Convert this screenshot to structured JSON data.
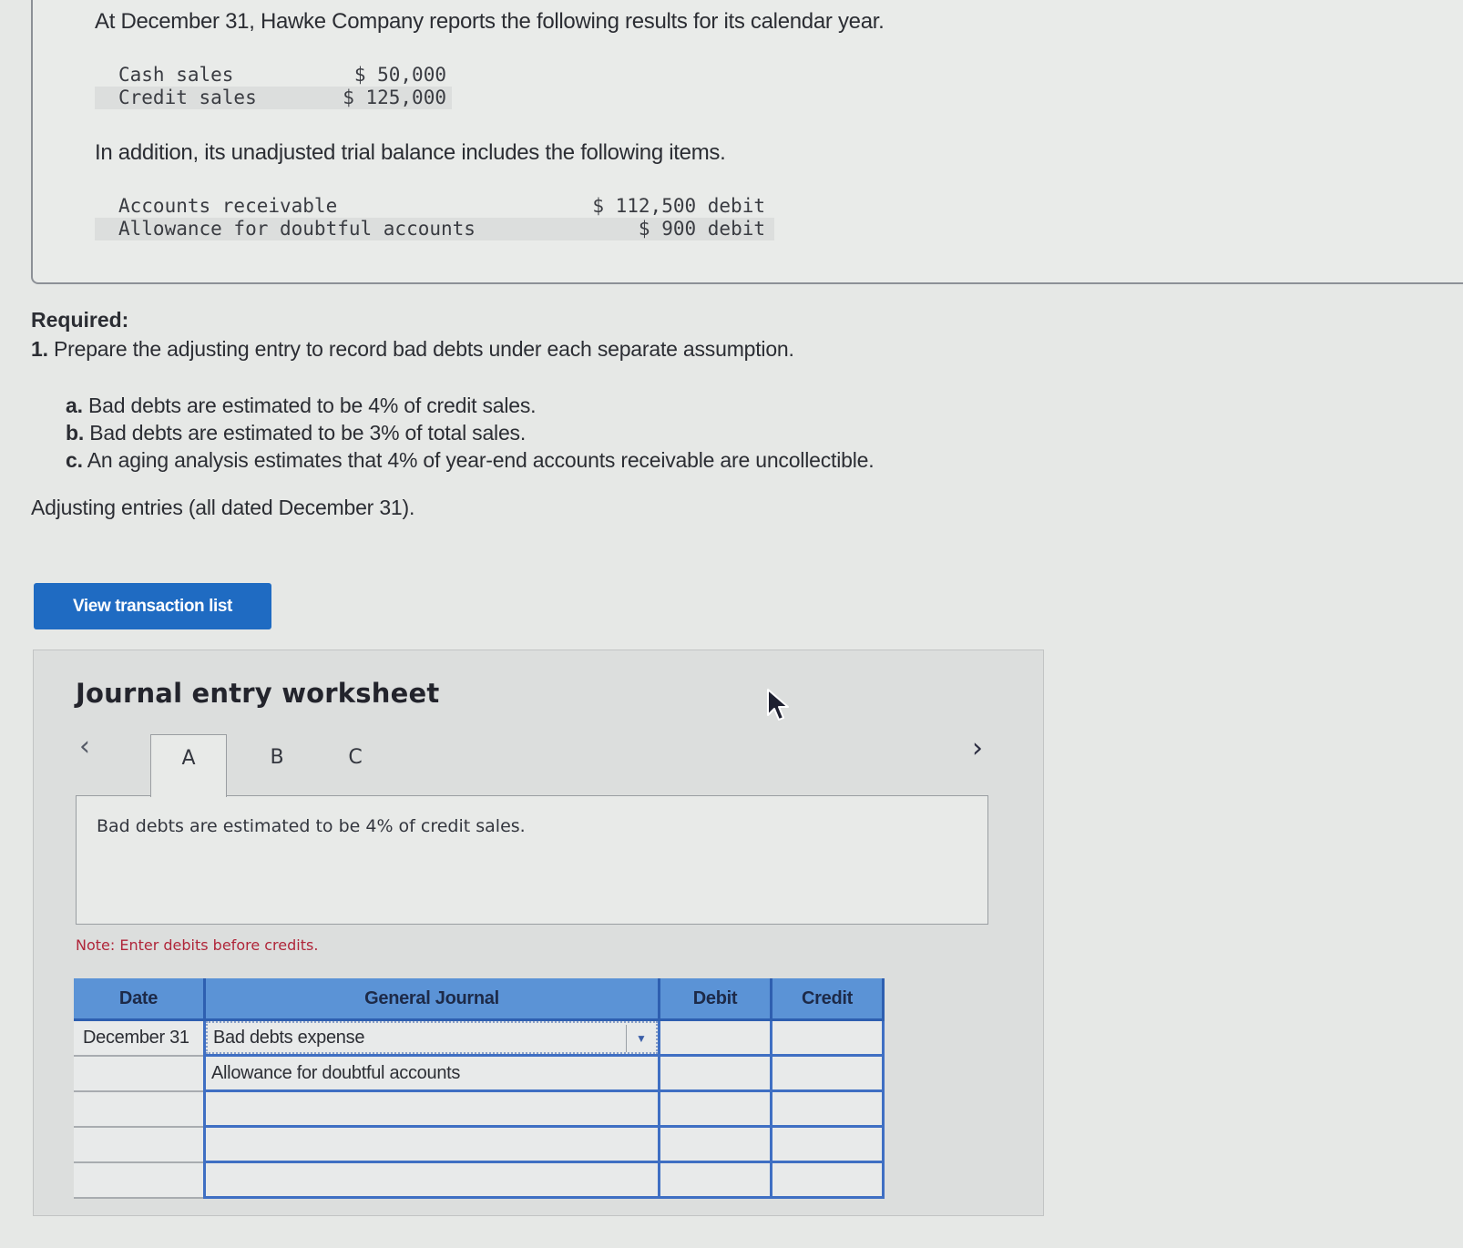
{
  "problem": {
    "intro": "At December 31, Hawke Company reports the following results for its calendar year.",
    "sales": [
      {
        "label": "Cash sales",
        "value": "$ 50,000"
      },
      {
        "label": "Credit sales",
        "value": "$ 125,000"
      }
    ],
    "trial_balance_intro": "In addition, its unadjusted trial balance includes the following items.",
    "trial_balance": [
      {
        "label": "Accounts receivable",
        "value": "$ 112,500 debit"
      },
      {
        "label": "Allowance for doubtful accounts",
        "value": "$ 900 debit"
      }
    ]
  },
  "required": {
    "heading": "Required:",
    "item_number": "1.",
    "item_text": "Prepare the adjusting entry to record bad debts under each separate assumption.",
    "assumptions": [
      {
        "letter": "a.",
        "text": "Bad debts are estimated to be 4% of credit sales."
      },
      {
        "letter": "b.",
        "text": "Bad debts are estimated to be 3% of total sales."
      },
      {
        "letter": "c.",
        "text": "An aging analysis estimates that 4% of year-end accounts receivable are uncollectible."
      }
    ],
    "adjusting_note": "Adjusting entries (all dated December 31)."
  },
  "view_transaction_button": "View transaction list",
  "worksheet": {
    "title": "Journal entry worksheet",
    "prev_icon": "‹",
    "next_icon": "›",
    "tabs": [
      {
        "label": "A",
        "active": true
      },
      {
        "label": "B",
        "active": false
      },
      {
        "label": "C",
        "active": false
      }
    ],
    "panel_text": "Bad debts are estimated to be 4% of credit sales.",
    "note": "Note: Enter debits before credits.",
    "table": {
      "headers": {
        "date": "Date",
        "general_journal": "General Journal",
        "debit": "Debit",
        "credit": "Credit"
      },
      "rows": [
        {
          "date": "December 31",
          "account": "Bad debts expense",
          "debit": "",
          "credit": ""
        },
        {
          "date": "",
          "account": "Allowance for doubtful accounts",
          "debit": "",
          "credit": ""
        },
        {
          "date": "",
          "account": "",
          "debit": "",
          "credit": ""
        },
        {
          "date": "",
          "account": "",
          "debit": "",
          "credit": ""
        },
        {
          "date": "",
          "account": "",
          "debit": "",
          "credit": ""
        }
      ]
    }
  },
  "colors": {
    "button_blue": "#1f6bc2",
    "table_header_blue": "#5b93d6",
    "note_red": "#b0263a"
  }
}
